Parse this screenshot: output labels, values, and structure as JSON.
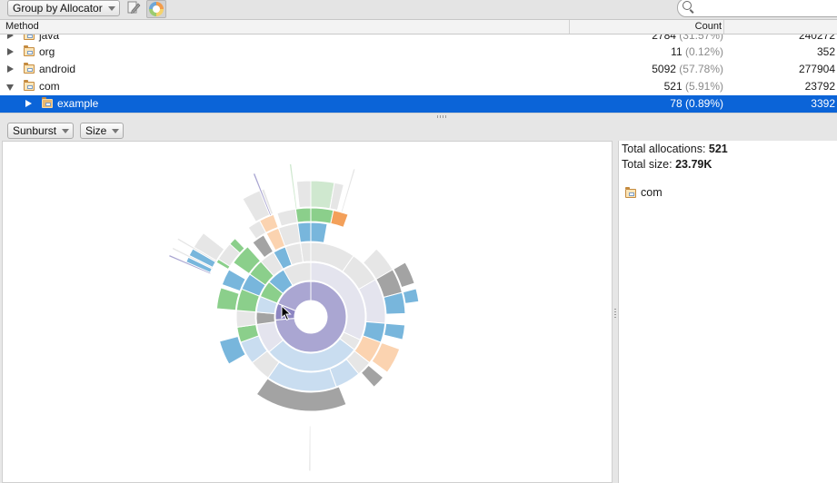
{
  "toolbar": {
    "group_by": "Group by Allocator",
    "icons": [
      "edit-icon",
      "sunburst-chart-icon"
    ]
  },
  "table": {
    "columns": [
      "Method",
      "Count"
    ],
    "rows": [
      {
        "name": "java",
        "count": "2784",
        "pct": "(31.57%)",
        "size": "240272",
        "expanded": false,
        "depth": 0
      },
      {
        "name": "org",
        "count": "11",
        "pct": "(0.12%)",
        "size": "352",
        "expanded": false,
        "depth": 0
      },
      {
        "name": "android",
        "count": "5092",
        "pct": "(57.78%)",
        "size": "277904",
        "expanded": false,
        "depth": 0
      },
      {
        "name": "com",
        "count": "521",
        "pct": "(5.91%)",
        "size": "23792",
        "expanded": true,
        "depth": 0
      },
      {
        "name": "example",
        "count": "78",
        "pct": "(0.89%)",
        "size": "3392",
        "expanded": false,
        "depth": 1,
        "selected": true
      }
    ]
  },
  "view_controls": {
    "chart_type": "Sunburst",
    "metric": "Size"
  },
  "info": {
    "total_allocations_label": "Total allocations:",
    "total_allocations": "521",
    "total_size_label": "Total size:",
    "total_size": "23.79K",
    "selected_name": "com"
  },
  "colors": {
    "selection": "#0b64d8",
    "purple": "#aaa6d2",
    "light_blue": "#c9ddf0",
    "pale_lavender": "#e4e4ee",
    "light_gray": "#e6e6e6",
    "dark_gray": "#a3a3a3",
    "blue": "#78b6dc",
    "green": "#8bcf8b",
    "orange": "#f3a05a",
    "peach": "#fbd3b0"
  }
}
